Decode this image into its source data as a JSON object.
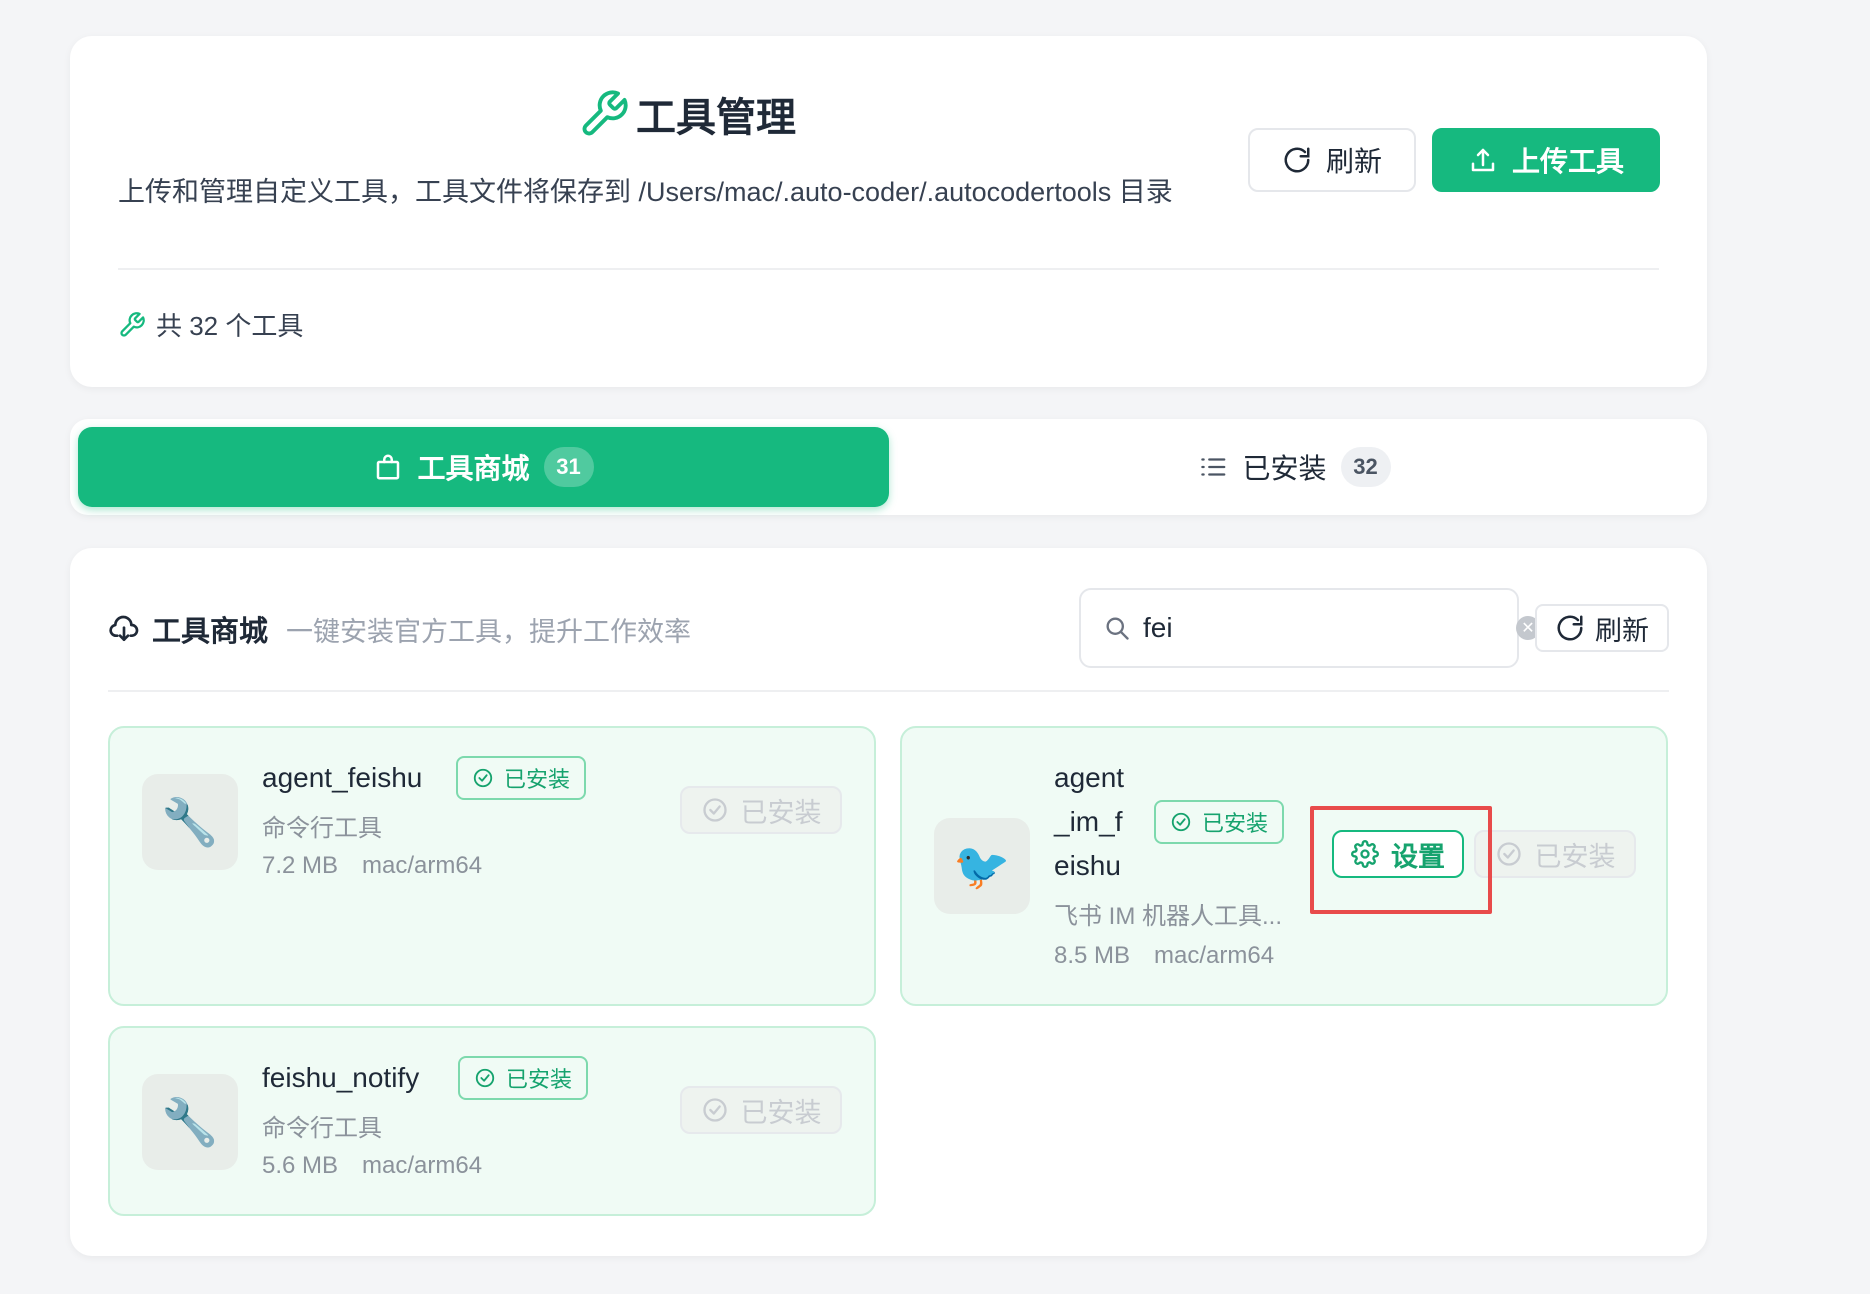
{
  "header": {
    "title": "工具管理",
    "description": "上传和管理自定义工具，工具文件将保存到 /Users/mac/.auto-coder/.autocodertools 目录",
    "refresh_label": "刷新",
    "upload_label": "上传工具",
    "count_label": "共 32 个工具"
  },
  "tabs": [
    {
      "label": "工具商城",
      "badge": "31",
      "active": true,
      "icon": "shopping-bag-icon"
    },
    {
      "label": "已安装",
      "badge": "32",
      "active": false,
      "icon": "list-icon"
    }
  ],
  "store": {
    "title": "工具商城",
    "subtitle": "一键安装官方工具，提升工作效率",
    "search": {
      "value": "fei",
      "placeholder": ""
    },
    "refresh_label": "刷新",
    "tools": [
      {
        "name": "agent_feishu",
        "status": "已安装",
        "type": "命令行工具",
        "size": "7.2 MB",
        "platform": "mac/arm64",
        "icon": "wrench-icon",
        "action": "已安装"
      },
      {
        "name_lines": [
          "agent",
          "_im_f",
          "eishu"
        ],
        "status": "已安装",
        "type": "飞书 IM 机器人工具...",
        "size": "8.5 MB",
        "platform": "mac/arm64",
        "icon": "bird-icon",
        "settings_label": "设置",
        "action": "已安装"
      },
      {
        "name": "feishu_notify",
        "status": "已安装",
        "type": "命令行工具",
        "size": "5.6 MB",
        "platform": "mac/arm64",
        "icon": "wrench-icon",
        "action": "已安装"
      }
    ]
  },
  "colors": {
    "accent": "#16b97f",
    "highlight": "#e84b4b"
  }
}
